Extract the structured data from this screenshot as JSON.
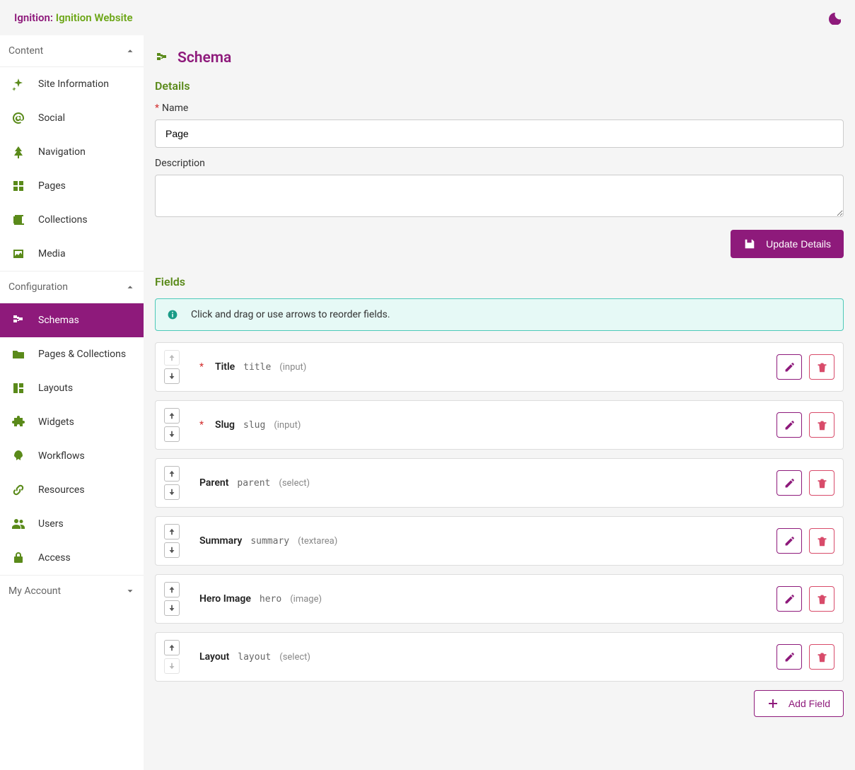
{
  "header": {
    "brand_primary": "Ignition:",
    "brand_secondary": "Ignition Website"
  },
  "sidebar": {
    "sections": {
      "content": {
        "title": "Content",
        "items": [
          {
            "label": "Site Information",
            "icon": "sparkle"
          },
          {
            "label": "Social",
            "icon": "at"
          },
          {
            "label": "Navigation",
            "icon": "tree"
          },
          {
            "label": "Pages",
            "icon": "pages"
          },
          {
            "label": "Collections",
            "icon": "collections"
          },
          {
            "label": "Media",
            "icon": "image"
          }
        ]
      },
      "configuration": {
        "title": "Configuration",
        "items": [
          {
            "label": "Schemas",
            "icon": "schema",
            "active": true
          },
          {
            "label": "Pages & Collections",
            "icon": "folder"
          },
          {
            "label": "Layouts",
            "icon": "layout"
          },
          {
            "label": "Widgets",
            "icon": "puzzle"
          },
          {
            "label": "Workflows",
            "icon": "rocket"
          },
          {
            "label": "Resources",
            "icon": "link"
          },
          {
            "label": "Users",
            "icon": "users"
          },
          {
            "label": "Access",
            "icon": "lock"
          }
        ]
      },
      "account": {
        "title": "My Account"
      }
    }
  },
  "page": {
    "title": "Schema",
    "details": {
      "section_title": "Details",
      "name_label": "Name",
      "name_value": "Page",
      "description_label": "Description",
      "description_value": "",
      "update_button": "Update Details"
    },
    "fields": {
      "section_title": "Fields",
      "info_text": "Click and drag or use arrows to reorder fields.",
      "items": [
        {
          "required": true,
          "name": "Title",
          "key": "title",
          "type": "(input)",
          "up_disabled": true,
          "down_disabled": false
        },
        {
          "required": true,
          "name": "Slug",
          "key": "slug",
          "type": "(input)",
          "up_disabled": false,
          "down_disabled": false
        },
        {
          "required": false,
          "name": "Parent",
          "key": "parent",
          "type": "(select)",
          "up_disabled": false,
          "down_disabled": false
        },
        {
          "required": false,
          "name": "Summary",
          "key": "summary",
          "type": "(textarea)",
          "up_disabled": false,
          "down_disabled": false
        },
        {
          "required": false,
          "name": "Hero Image",
          "key": "hero",
          "type": "(image)",
          "up_disabled": false,
          "down_disabled": false
        },
        {
          "required": false,
          "name": "Layout",
          "key": "layout",
          "type": "(select)",
          "up_disabled": false,
          "down_disabled": true
        }
      ],
      "add_button": "Add Field"
    }
  }
}
